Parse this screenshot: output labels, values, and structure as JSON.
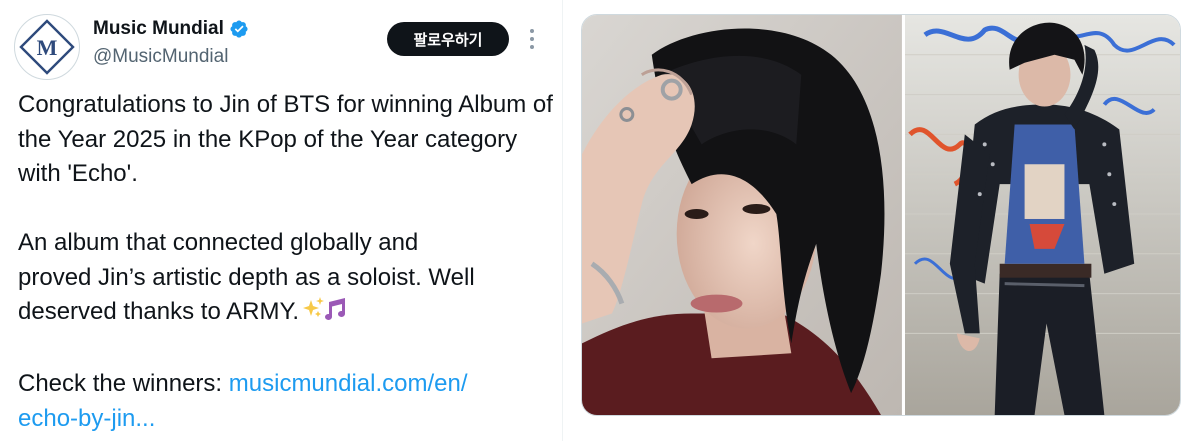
{
  "account": {
    "display_name": "Music Mundial",
    "handle": "@MusicMundial",
    "avatar_letter": "M",
    "verified": true
  },
  "actions": {
    "follow_label": "팔로우하기"
  },
  "tweet": {
    "paragraph1": "Congratulations to Jin of BTS for winning Album of the Year 2025 in the KPop of the Year category with 'Echo'.",
    "paragraph2_line1": "An album that connected globally and",
    "paragraph2_line2": "proved Jin’s artistic depth as a soloist. Well",
    "paragraph2_line3": "deserved thanks to ARMY.",
    "paragraph3_prefix": "Check the winners: ",
    "link_line1": "musicmundial.com/en/",
    "link_line2": "echo-by-jin..."
  },
  "icons": {
    "verified": "verified-badge-icon",
    "more": "more-vertical-icon",
    "emoji": "sparkles-music-notes-icon"
  },
  "colors": {
    "link": "#1d9bf0",
    "verified": "#1d9bf0",
    "follow_bg": "#0f1419",
    "avatar_brand": "#2e4a7c"
  },
  "media": {
    "images": [
      {
        "alt": "photo-left"
      },
      {
        "alt": "photo-right"
      }
    ]
  }
}
